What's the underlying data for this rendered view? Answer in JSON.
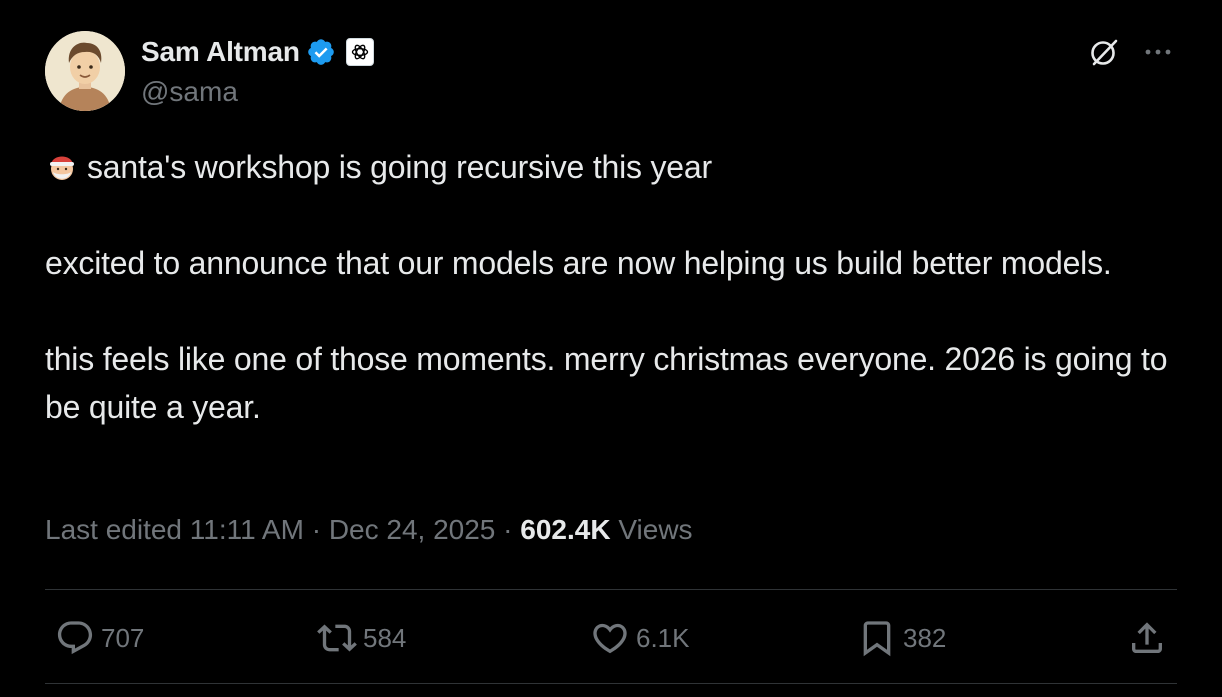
{
  "author": {
    "display_name": "Sam Altman",
    "handle": "@sama",
    "verified_icon": "verified-badge-icon",
    "affiliate_icon": "openai-logo-icon",
    "verified_color": "#1d9bf0"
  },
  "tweet": {
    "line1": "santa's workshop is going recursive this year",
    "line1_emoji": "santa-emoji-icon",
    "paragraph2": "excited to announce that our models are now helping us build better models.",
    "paragraph3": "this feels like one of those moments. merry christmas everyone. 2026 is going to be quite a year."
  },
  "meta": {
    "edited_label": "Last edited 11:11 AM",
    "separator": "·",
    "date": "Dec 24, 2025",
    "views_count": "602.4K",
    "views_label": "Views"
  },
  "actions": {
    "replies": "707",
    "reposts": "584",
    "likes": "6.1K",
    "bookmarks": "382"
  },
  "colors": {
    "background": "#000000",
    "text": "#e7e9ea",
    "secondary": "#71767b",
    "divider": "#2f3336"
  }
}
